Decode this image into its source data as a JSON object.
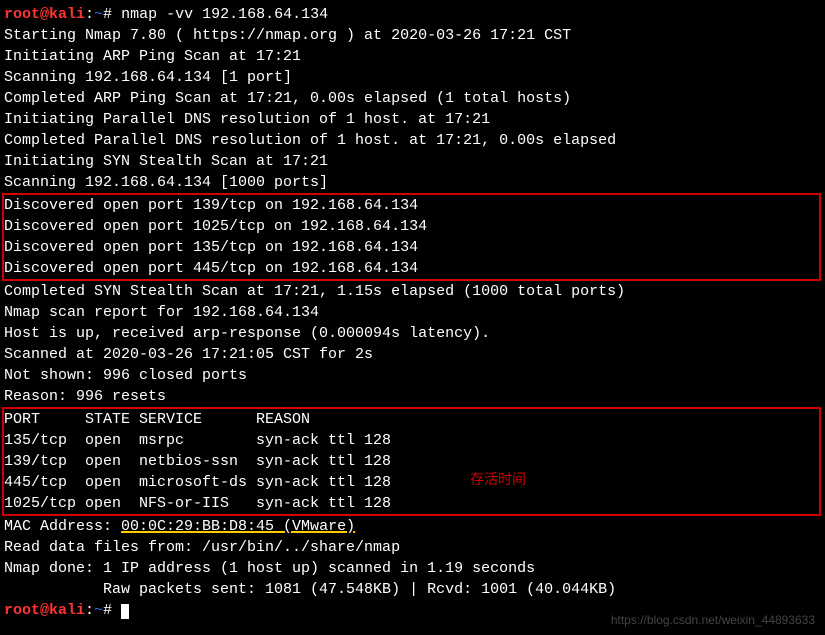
{
  "prompt": {
    "user": "root@kali",
    "sep1": ":",
    "path": "~",
    "sep2": "# "
  },
  "command": "nmap -vv 192.168.64.134",
  "lines": {
    "l01": "Starting Nmap 7.80 ( https://nmap.org ) at 2020-03-26 17:21 CST",
    "l02": "Initiating ARP Ping Scan at 17:21",
    "l03": "Scanning 192.168.64.134 [1 port]",
    "l04": "Completed ARP Ping Scan at 17:21, 0.00s elapsed (1 total hosts)",
    "l05": "Initiating Parallel DNS resolution of 1 host. at 17:21",
    "l06": "Completed Parallel DNS resolution of 1 host. at 17:21, 0.00s elapsed",
    "l07": "Initiating SYN Stealth Scan at 17:21",
    "l08": "Scanning 192.168.64.134 [1000 ports]",
    "l09": "Discovered open port 139/tcp on 192.168.64.134",
    "l10": "Discovered open port 1025/tcp on 192.168.64.134",
    "l11": "Discovered open port 135/tcp on 192.168.64.134",
    "l12": "Discovered open port 445/tcp on 192.168.64.134",
    "l13": "Completed SYN Stealth Scan at 17:21, 1.15s elapsed (1000 total ports)",
    "l14": "Nmap scan report for 192.168.64.134",
    "l15": "Host is up, received arp-response (0.000094s latency).",
    "l16": "Scanned at 2020-03-26 17:21:05 CST for 2s",
    "l17": "Not shown: 996 closed ports",
    "l18": "Reason: 996 resets",
    "l19": "PORT     STATE SERVICE      REASON",
    "l20": "135/tcp  open  msrpc        syn-ack ttl 128",
    "l21": "139/tcp  open  netbios-ssn  syn-ack ttl 128",
    "l22": "445/tcp  open  microsoft-ds syn-ack ttl 128",
    "l23": "1025/tcp open  NFS-or-IIS   syn-ack ttl 128",
    "l24a": "MAC Address: ",
    "l24b": "00:0C:29:BB:D8:45 (VMware)",
    "l25": "",
    "l26": "Read data files from: /usr/bin/../share/nmap",
    "l27": "Nmap done: 1 IP address (1 host up) scanned in 1.19 seconds",
    "l28": "           Raw packets sent: 1081 (47.548KB) | Rcvd: 1001 (40.044KB)"
  },
  "annotation": "存活时间",
  "watermark": "https://blog.csdn.net/weixin_44893633"
}
